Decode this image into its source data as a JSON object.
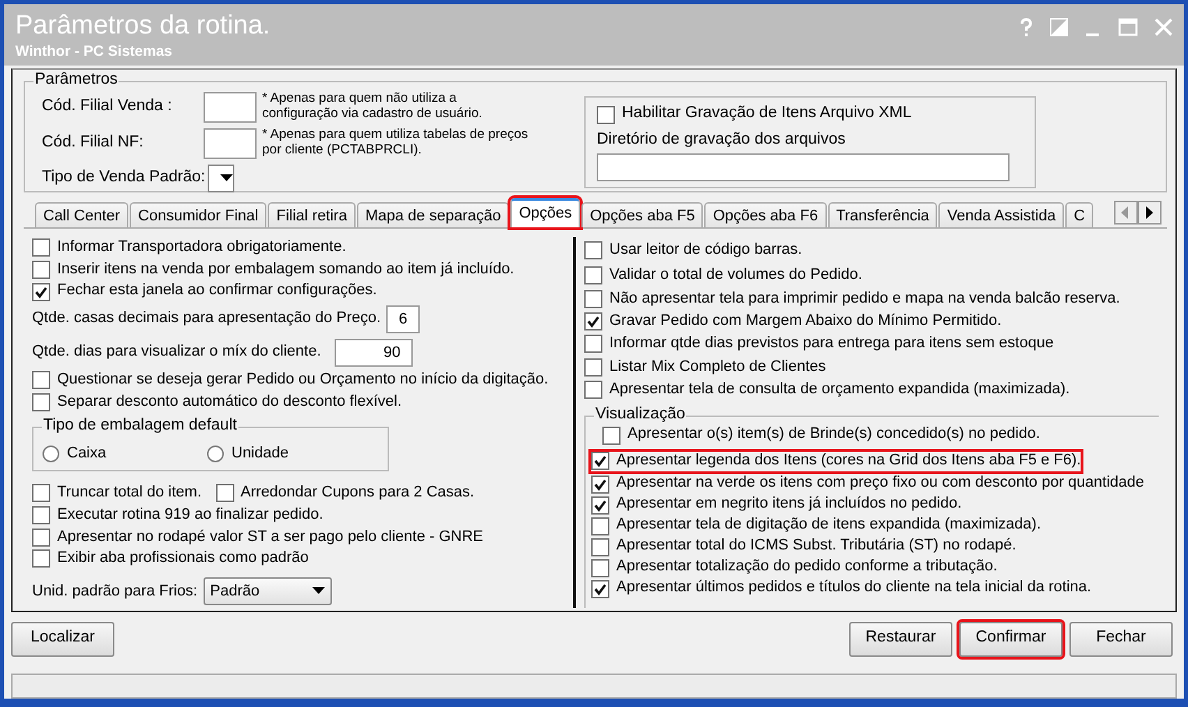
{
  "window": {
    "title": "Parâmetros da rotina.",
    "subtitle": "Winthor - PC Sistemas"
  },
  "parametros": {
    "legend": "Parâmetros",
    "fields": [
      {
        "label": "Cód. Filial Venda :",
        "note": "* Apenas para quem não utiliza a configuração via cadastro de usuário."
      },
      {
        "label": "Cód. Filial NF:",
        "note": "* Apenas para quem utiliza tabelas de preços por cliente (PCTABPRCLI)."
      }
    ],
    "tipo_venda": {
      "label": "Tipo de Venda Padrão:"
    },
    "xml": {
      "label": "Habilitar Gravação de Itens Arquivo XML",
      "checked": false,
      "dir_label": "Diretório de gravação dos arquivos"
    }
  },
  "tabs": [
    {
      "label": "Call Center",
      "selected": false,
      "highlighted": false
    },
    {
      "label": "Consumidor Final",
      "selected": false,
      "highlighted": false
    },
    {
      "label": "Filial retira",
      "selected": false,
      "highlighted": false
    },
    {
      "label": "Mapa de separação",
      "selected": false,
      "highlighted": false
    },
    {
      "label": "Opções",
      "selected": true,
      "highlighted": true
    },
    {
      "label": "Opções aba F5",
      "selected": false,
      "highlighted": false
    },
    {
      "label": "Opções aba F6",
      "selected": false,
      "highlighted": false
    },
    {
      "label": "Transferência",
      "selected": false,
      "highlighted": false
    },
    {
      "label": "Venda Assistida",
      "selected": false,
      "highlighted": false
    },
    {
      "label": "C",
      "selected": false,
      "highlighted": false
    }
  ],
  "left_options": [
    {
      "kind": "checkbox",
      "label": "Informar Transportadora obrigatoriamente.",
      "checked": false
    },
    {
      "kind": "checkbox",
      "label": "Inserir itens na venda por embalagem somando ao item já incluído.",
      "checked": false
    },
    {
      "kind": "checkbox",
      "label": "Fechar esta janela ao confirmar configurações.",
      "checked": true
    },
    {
      "kind": "number",
      "label": "Qtde. casas decimais para apresentação do Preço.",
      "value": "6"
    },
    {
      "kind": "number",
      "label": "Qtde. dias para visualizar o míx do cliente.",
      "value": "90"
    },
    {
      "kind": "checkbox",
      "label": "Questionar se deseja gerar Pedido ou Orçamento no início da digitação.",
      "checked": false
    },
    {
      "kind": "checkbox",
      "label": "Separar desconto automático do desconto flexível.",
      "checked": false
    },
    {
      "kind": "radio_group",
      "legend": "Tipo de embalagem default",
      "options": [
        {
          "label": "Caixa",
          "selected": false
        },
        {
          "label": "Unidade",
          "selected": false
        }
      ]
    },
    {
      "kind": "checkbox_pair",
      "items": [
        {
          "label": "Truncar total do item.",
          "checked": false
        },
        {
          "label": "Arredondar Cupons para 2 Casas.",
          "checked": false
        }
      ]
    },
    {
      "kind": "checkbox",
      "label": "Executar rotina 919 ao finalizar pedido.",
      "checked": false
    },
    {
      "kind": "checkbox",
      "label": "Apresentar no rodapé valor ST a ser pago pelo cliente - GNRE",
      "checked": false
    },
    {
      "kind": "checkbox",
      "label": "Exibir aba profissionais como padrão",
      "checked": false
    },
    {
      "kind": "select",
      "label": "Unid. padrão para Frios:",
      "value": "Padrão"
    }
  ],
  "right_options": [
    {
      "label": "Usar leitor de código barras.",
      "checked": false
    },
    {
      "label": "Validar o total de volumes do Pedido.",
      "checked": false
    },
    {
      "label": "Não apresentar tela para imprimir pedido e mapa na venda balcão reserva.",
      "checked": false
    },
    {
      "label": "Gravar Pedido com Margem Abaixo do Mínimo Permitido.",
      "checked": true
    },
    {
      "label": "Informar qtde dias previstos para entrega para itens sem estoque",
      "checked": false
    },
    {
      "label": "Listar Mix Completo de Clientes",
      "checked": false
    },
    {
      "label": "Apresentar tela de consulta de orçamento expandida (maximizada).",
      "checked": false
    }
  ],
  "visualizacao": {
    "legend": "Visualização",
    "items": [
      {
        "label": "Apresentar o(s) item(s) de Brinde(s) concedido(s) no pedido.",
        "checked": false,
        "highlighted": false
      },
      {
        "label": "Apresentar legenda dos Itens (cores na Grid dos Itens aba F5 e F6).",
        "checked": true,
        "highlighted": true
      },
      {
        "label": "Apresentar na verde os itens com preço fixo ou com desconto por quantidade",
        "checked": true,
        "highlighted": false
      },
      {
        "label": "Apresentar em negrito itens já incluídos no pedido.",
        "checked": true,
        "highlighted": false
      },
      {
        "label": "Apresentar tela de digitação de itens expandida (maximizada).",
        "checked": false,
        "highlighted": false
      },
      {
        "label": "Apresentar total do ICMS Subst. Tributária (ST) no rodapé.",
        "checked": false,
        "highlighted": false
      },
      {
        "label": "Apresentar totalização do pedido conforme a tributação.",
        "checked": false,
        "highlighted": false
      },
      {
        "label": "Apresentar últimos pedidos e títulos do cliente na tela inicial da rotina.",
        "checked": true,
        "highlighted": false
      }
    ]
  },
  "buttons": [
    {
      "label": "Localizar",
      "highlighted": false
    },
    {
      "label": "Restaurar",
      "highlighted": false
    },
    {
      "label": "Confirmar",
      "highlighted": true
    },
    {
      "label": "Fechar",
      "highlighted": false
    }
  ]
}
